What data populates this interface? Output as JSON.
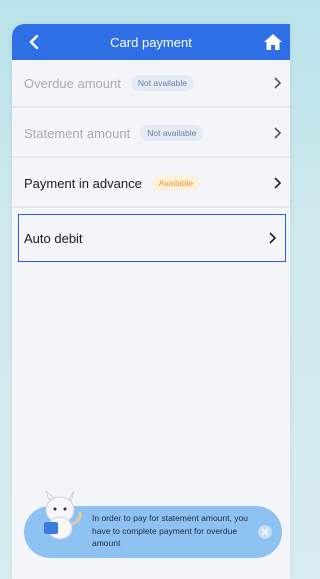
{
  "header": {
    "title": "Card payment",
    "back_icon": "back-chevron-icon",
    "home_icon": "home-icon"
  },
  "menu": [
    {
      "label": "Overdue amount",
      "badge": "Not available",
      "enabled": false
    },
    {
      "label": "Statement amount",
      "badge": "Not available",
      "enabled": false
    },
    {
      "label": "Payment in advance",
      "badge": "Available",
      "enabled": true
    },
    {
      "label": "Auto debit",
      "badge": "",
      "enabled": true,
      "selected": true
    }
  ],
  "toast": {
    "message": "In order to pay for statement amount, you have to complete payment for overdue amount",
    "close_icon": "close-icon",
    "mascot_icon": "mascot-icon"
  },
  "colors": {
    "header": "#2f6fe6",
    "available_badge": "#f09a1c",
    "selection_border": "#2f5fd6",
    "toast_bg": "#8ec2f3"
  }
}
